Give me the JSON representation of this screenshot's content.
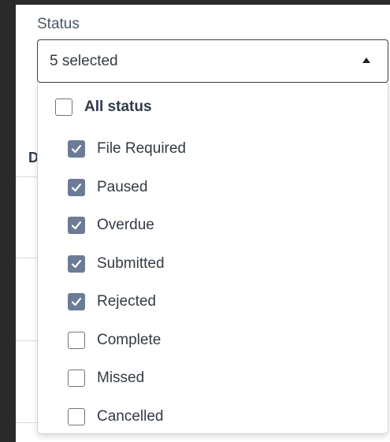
{
  "filter": {
    "label": "Status",
    "selected_text": "5 selected",
    "caret_icon": "caret-up-icon"
  },
  "background": {
    "column_header_initial": "D"
  },
  "dropdown": {
    "all_option": {
      "label": "All status",
      "checked": false
    },
    "options": [
      {
        "label": "File Required",
        "checked": true
      },
      {
        "label": "Paused",
        "checked": true
      },
      {
        "label": "Overdue",
        "checked": true
      },
      {
        "label": "Submitted",
        "checked": true
      },
      {
        "label": "Rejected",
        "checked": true
      },
      {
        "label": "Complete",
        "checked": false
      },
      {
        "label": "Missed",
        "checked": false
      },
      {
        "label": "Cancelled",
        "checked": false
      }
    ]
  },
  "colors": {
    "checkbox_checked": "#6c7b96",
    "text": "#333a44",
    "select_border": "#3a3f48"
  }
}
